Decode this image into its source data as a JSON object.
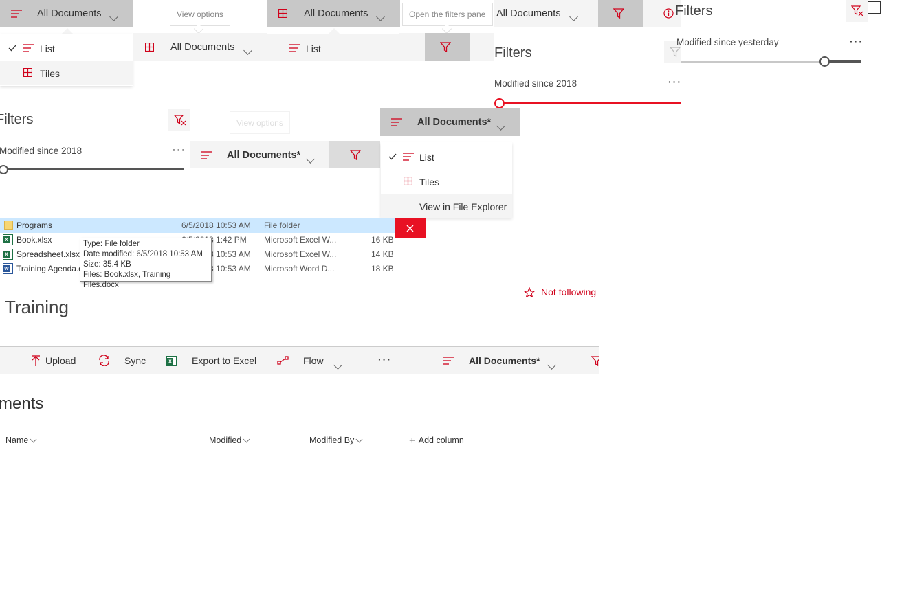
{
  "strip": {
    "view_all_documents": "All Documents",
    "view_options_callout": "View options",
    "filters_pane_callout": "Open the filters pane",
    "list": "List",
    "tiles": "Tiles"
  },
  "filters_right": {
    "title": "Filters",
    "modified_label": "Modified since yesterday",
    "slider_value": 0.8
  },
  "filters_mid": {
    "title": "Filters",
    "modified_label": "Modified since 2018",
    "slider_value": 0.0
  },
  "filters_left": {
    "title": "Filters",
    "modified_label": "Modified since 2018",
    "slider_value": 0.0
  },
  "view_bar": {
    "label": "All Documents*",
    "faded_callout": "View options"
  },
  "view_dropdown": {
    "label": "All Documents*",
    "items": [
      "List",
      "Tiles",
      "View in File Explorer"
    ]
  },
  "files": [
    {
      "name": "Programs",
      "modified": "6/5/2018 10:53 AM",
      "type": "File folder",
      "size": "",
      "icon": "folder-icon"
    },
    {
      "name": "Book.xlsx",
      "modified": "6/5/2018 1:42 PM",
      "type": "Microsoft Excel W...",
      "size": "16 KB",
      "icon": "excel-icon"
    },
    {
      "name": "Spreadsheet.xlsx",
      "modified": "6/5/2018 10:53 AM",
      "type": "Microsoft Excel W...",
      "size": "14 KB",
      "icon": "excel-icon"
    },
    {
      "name": "Training Agenda.docx",
      "modified": "6/5/2018 10:53 AM",
      "type": "Microsoft Word D...",
      "size": "18 KB",
      "icon": "word-icon"
    }
  ],
  "tooltip": {
    "type": "Type: File folder",
    "date": "Date modified: 6/5/2018 10:53 AM",
    "size": "Size: 35.4 KB",
    "files": "Files: Book.xlsx, Training Files.docx"
  },
  "site": {
    "title": "Training",
    "follow": "Not following"
  },
  "command_bar": {
    "upload": "Upload",
    "sync": "Sync",
    "export": "Export to Excel",
    "flow": "Flow",
    "more": "···",
    "view": "All Documents*"
  },
  "library": {
    "title_fragment": "ments",
    "columns": [
      "Name",
      "Modified",
      "Modified By"
    ],
    "add_column": "Add column"
  },
  "colors": {
    "accent": "#d0021b",
    "bar_grey": "#c8c8c8",
    "selection": "#cce8ff"
  }
}
